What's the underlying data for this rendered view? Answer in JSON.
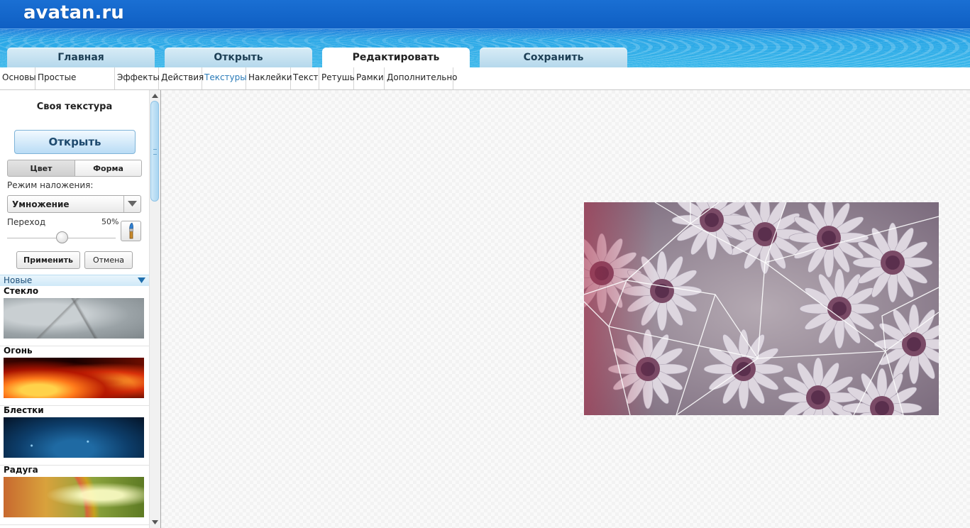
{
  "site": {
    "logo": "avatan.ru"
  },
  "tabs": [
    {
      "label": "Главная",
      "active": false
    },
    {
      "label": "Открыть",
      "active": false
    },
    {
      "label": "Редактировать",
      "active": true
    },
    {
      "label": "Сохранить",
      "active": false
    }
  ],
  "submenu": [
    {
      "label": "Основы",
      "active": false
    },
    {
      "label": "Простые фильтры",
      "active": false
    },
    {
      "label": "Эффекты",
      "active": false
    },
    {
      "label": "Действия",
      "active": false
    },
    {
      "label": "Текстуры",
      "active": true
    },
    {
      "label": "Наклейки",
      "active": false
    },
    {
      "label": "Текст",
      "active": false
    },
    {
      "label": "Ретушь",
      "active": false
    },
    {
      "label": "Рамки",
      "active": false
    },
    {
      "label": "Дополнительно",
      "active": false
    }
  ],
  "panel": {
    "title": "Своя текстура",
    "open_button": "Открыть",
    "segments": {
      "color": "Цвет",
      "shape": "Форма",
      "selected": "color"
    },
    "blend_label": "Режим наложения:",
    "blend_value": "Умножение",
    "transition_label": "Переход",
    "transition_value": "50%",
    "transition_level": 0.5,
    "apply_button": "Применить",
    "cancel_button": "Отмена",
    "category": "Новые",
    "textures": [
      {
        "name": "Стекло",
        "style": "glass"
      },
      {
        "name": "Огонь",
        "style": "fire"
      },
      {
        "name": "Блестки",
        "style": "sparkle"
      },
      {
        "name": "Радуга",
        "style": "rainbow"
      }
    ]
  },
  "colors": {
    "header_blue": "#1366c9",
    "active_tab_text": "#2a7bb8"
  }
}
